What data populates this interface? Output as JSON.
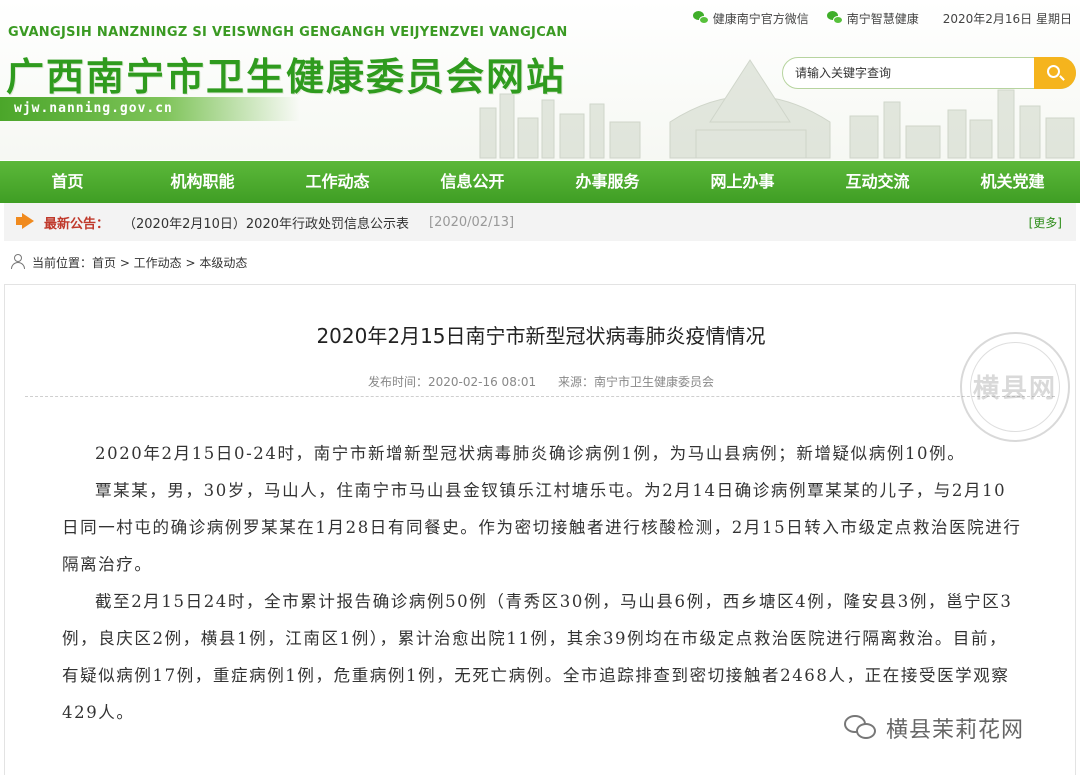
{
  "header": {
    "pinyin": "GVANGJSIH NANZNINGZ SI VEISWNGH GENGANGH VEIJYENZVEI VANGJCAN",
    "title": "广西南宁市卫生健康委员会网站",
    "url": "wjw.nanning.gov.cn",
    "links": [
      "健康南宁官方微信",
      "南宁智慧健康"
    ],
    "date": "2020年2月16日 星期日",
    "search_placeholder": "请输入关键字查询"
  },
  "nav": [
    "首页",
    "机构职能",
    "工作动态",
    "信息公开",
    "办事服务",
    "网上办事",
    "互动交流",
    "机关党建"
  ],
  "notice": {
    "label": "最新公告：",
    "text": "（2020年2月10日）2020年行政处罚信息公示表",
    "date": "[2020/02/13]",
    "more": "[更多]"
  },
  "breadcrumb": "当前位置：首页 > 工作动态 > 本级动态",
  "article": {
    "title": "2020年2月15日南宁市新型冠状病毒肺炎疫情情况",
    "publish_time": "发布时间：2020-02-16 08:01",
    "source": "来源：南宁市卫生健康委员会",
    "paragraphs": [
      "2020年2月15日0-24时，南宁市新增新型冠状病毒肺炎确诊病例1例，为马山县病例；新增疑似病例10例。",
      "覃某某，男，30岁，马山人，住南宁市马山县金钗镇乐江村塘乐屯。为2月14日确诊病例覃某某的儿子，与2月10日同一村屯的确诊病例罗某某在1月28日有同餐史。作为密切接触者进行核酸检测，2月15日转入市级定点救治医院进行隔离治疗。",
      "截至2月15日24时，全市累计报告确诊病例50例（青秀区30例，马山县6例，西乡塘区4例，隆安县3例，邕宁区3例，良庆区2例，横县1例，江南区1例），累计治愈出院11例，其余39例均在市级定点救治医院进行隔离救治。目前，有疑似病例17例，重症病例1例，危重病例1例，无死亡病例。全市追踪排查到密切接触者2468人，正在接受医学观察429人。"
    ]
  },
  "watermark": {
    "stamp": "横县网",
    "account": "横县茉莉花网"
  }
}
